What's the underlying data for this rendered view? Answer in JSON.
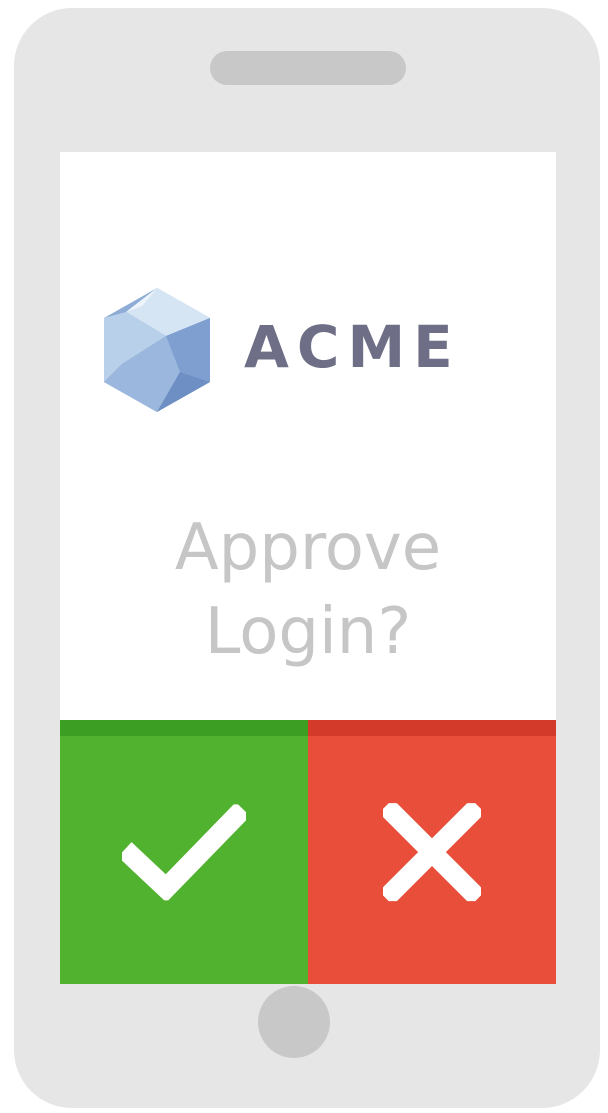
{
  "logo": {
    "name": "ACME",
    "mark_icon": "hexagon-gem-icon",
    "name_color": "#6e6e86",
    "mark_colors": [
      "#cfe0f2",
      "#8eadd6",
      "#6e8fc4"
    ]
  },
  "prompt": {
    "line1": "Approve",
    "line2": "Login?",
    "color": "#c6c6c6"
  },
  "actions": {
    "approve": {
      "icon": "checkmark-icon",
      "color": "#50b22e"
    },
    "deny": {
      "icon": "close-icon",
      "color": "#e84e3a"
    }
  },
  "device": {
    "body_color": "#e6e6e6",
    "detail_color": "#c8c8c8"
  }
}
